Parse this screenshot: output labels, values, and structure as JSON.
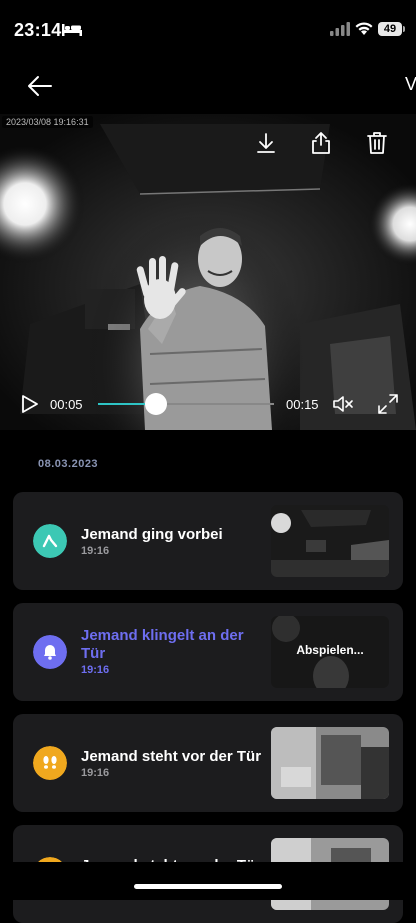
{
  "status_bar": {
    "time": "23:14",
    "battery": "49"
  },
  "nav": {
    "right_label": "V"
  },
  "video": {
    "timestamp": "2023/03/08 19:16:31",
    "current_time": "00:05",
    "total_time": "00:15",
    "progress": 0.33
  },
  "events": {
    "date": "08.03.2023",
    "items": [
      {
        "title": "Jemand ging vorbei",
        "time": "19:16",
        "icon": "person-walking-icon",
        "color": "#3cc8b4"
      },
      {
        "title": "Jemand klingelt an der Tür",
        "time": "19:16",
        "icon": "bell-icon",
        "color": "#6e6ef0",
        "active": true,
        "thumb_label": "Abspielen..."
      },
      {
        "title": "Jemand steht vor der Tür",
        "time": "19:16",
        "icon": "footprints-icon",
        "color": "#f0a81e"
      },
      {
        "title": "Jemand steht vor der Tür",
        "time": "",
        "icon": "footprints-icon",
        "color": "#f0a81e"
      }
    ]
  },
  "colors": {
    "accent": "#2ec4c5",
    "active_text": "#6e6ef0",
    "card": "#1c1c1e"
  }
}
